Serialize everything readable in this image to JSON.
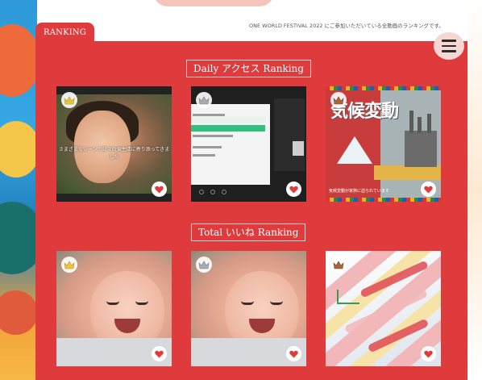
{
  "header": {
    "tab_label": "RANKING",
    "note": "ONE WORLD FESTIVAL 2022 にご参加いただいている全動画のランキングです。",
    "menu_icon": "hamburger-menu-icon"
  },
  "sections": [
    {
      "title": "Daily アクセス Ranking",
      "cards": [
        {
          "rank": 1,
          "badge_icon": "crown-gold-icon",
          "caption": "さまざまなシーンで日々の食生活に寄り添ってきました",
          "action_icon": "heart-icon"
        },
        {
          "rank": 2,
          "badge_icon": "crown-silver-icon",
          "caption": "",
          "action_icon": "heart-icon"
        },
        {
          "rank": 3,
          "badge_icon": "crown-bronze-icon",
          "caption": "気候変動",
          "sub_caption": "気候変動が家族に迫られています",
          "action_icon": "heart-icon"
        }
      ]
    },
    {
      "title": "Total いいね Ranking",
      "cards": [
        {
          "rank": 1,
          "badge_icon": "crown-gold-icon",
          "action_icon": "heart-icon"
        },
        {
          "rank": 2,
          "badge_icon": "crown-silver-icon",
          "action_icon": "heart-icon"
        },
        {
          "rank": 3,
          "badge_icon": "crown-bronze-icon",
          "action_icon": "heart-icon"
        }
      ]
    }
  ],
  "screen_card": {
    "lines": [
      "の学校給食と SDGs",
      "トレンドと国際ビジョン",
      "国による先進事例",
      "SDGs"
    ],
    "side_label": "The World We Live"
  },
  "colors": {
    "panel": "#df3a3c",
    "crown_gold": "#e8c53a",
    "crown_silver": "#a9acb0",
    "crown_bronze": "#a8653a",
    "heart": "#df3a3c"
  }
}
